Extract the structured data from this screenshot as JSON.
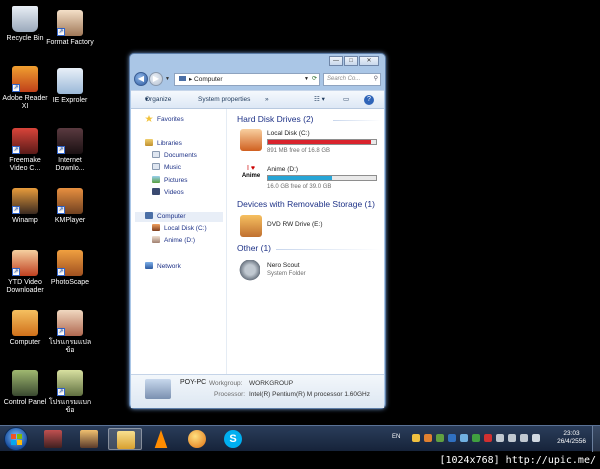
{
  "desktop": {
    "icons": [
      {
        "label": "Recycle Bin"
      },
      {
        "label": "Format Factory"
      },
      {
        "label": "Adobe Reader XI"
      },
      {
        "label": "IE Exproler"
      },
      {
        "label": "Freemake Video C..."
      },
      {
        "label": "Internet Downlo..."
      },
      {
        "label": "Winamp"
      },
      {
        "label": "KMPlayer"
      },
      {
        "label": "YTD Video Downloader"
      },
      {
        "label": "PhotoScape"
      },
      {
        "label": "Computer"
      },
      {
        "label": "โปรแกรมแปล ข้อ"
      },
      {
        "label": "Control Panel"
      },
      {
        "label": "โปรแกรมแบก ข้อ"
      }
    ]
  },
  "window": {
    "address": "Computer",
    "search_placeholder": "Search Co...",
    "toolbar": {
      "organize": "Organize",
      "system_properties": "System properties",
      "more": "»"
    },
    "nav": {
      "favorites": "Favorites",
      "libraries": "Libraries",
      "documents": "Documents",
      "music": "Music",
      "pictures": "Pictures",
      "videos": "Videos",
      "computer": "Computer",
      "local_disk": "Local Disk (C:)",
      "anime": "Anime  (D:)",
      "network": "Network"
    },
    "groups": {
      "hdd": "Hard Disk Drives (2)",
      "removable": "Devices with Removable Storage (1)",
      "other": "Other (1)"
    },
    "drives": [
      {
        "name": "Local Disk (C:)",
        "free": "891 MB free of 16.8 GB",
        "used_fraction": 0.95,
        "bar_color": "#d9232d"
      },
      {
        "name": "Anime  (D:)",
        "free": "16.0 GB free of 39.0 GB",
        "used_fraction": 0.59,
        "bar_color": "#27a5d6"
      }
    ],
    "drive_d_logo": "Anime",
    "dvd": {
      "name": "DVD RW Drive (E:)"
    },
    "other": {
      "name": "Nero Scout",
      "type": "System Folder"
    },
    "details": {
      "computer_name": "POY-PC",
      "workgroup_label": "Workgroup:",
      "workgroup": "WORKGROUP",
      "processor_label": "Processor:",
      "processor": "Intel(R) Pentium(R) M processor 1.60GHz"
    }
  },
  "taskbar": {
    "language": "EN",
    "time": "23:03",
    "date": "26/4/2556"
  },
  "watermark": "[1024x768] http://upic.me/"
}
